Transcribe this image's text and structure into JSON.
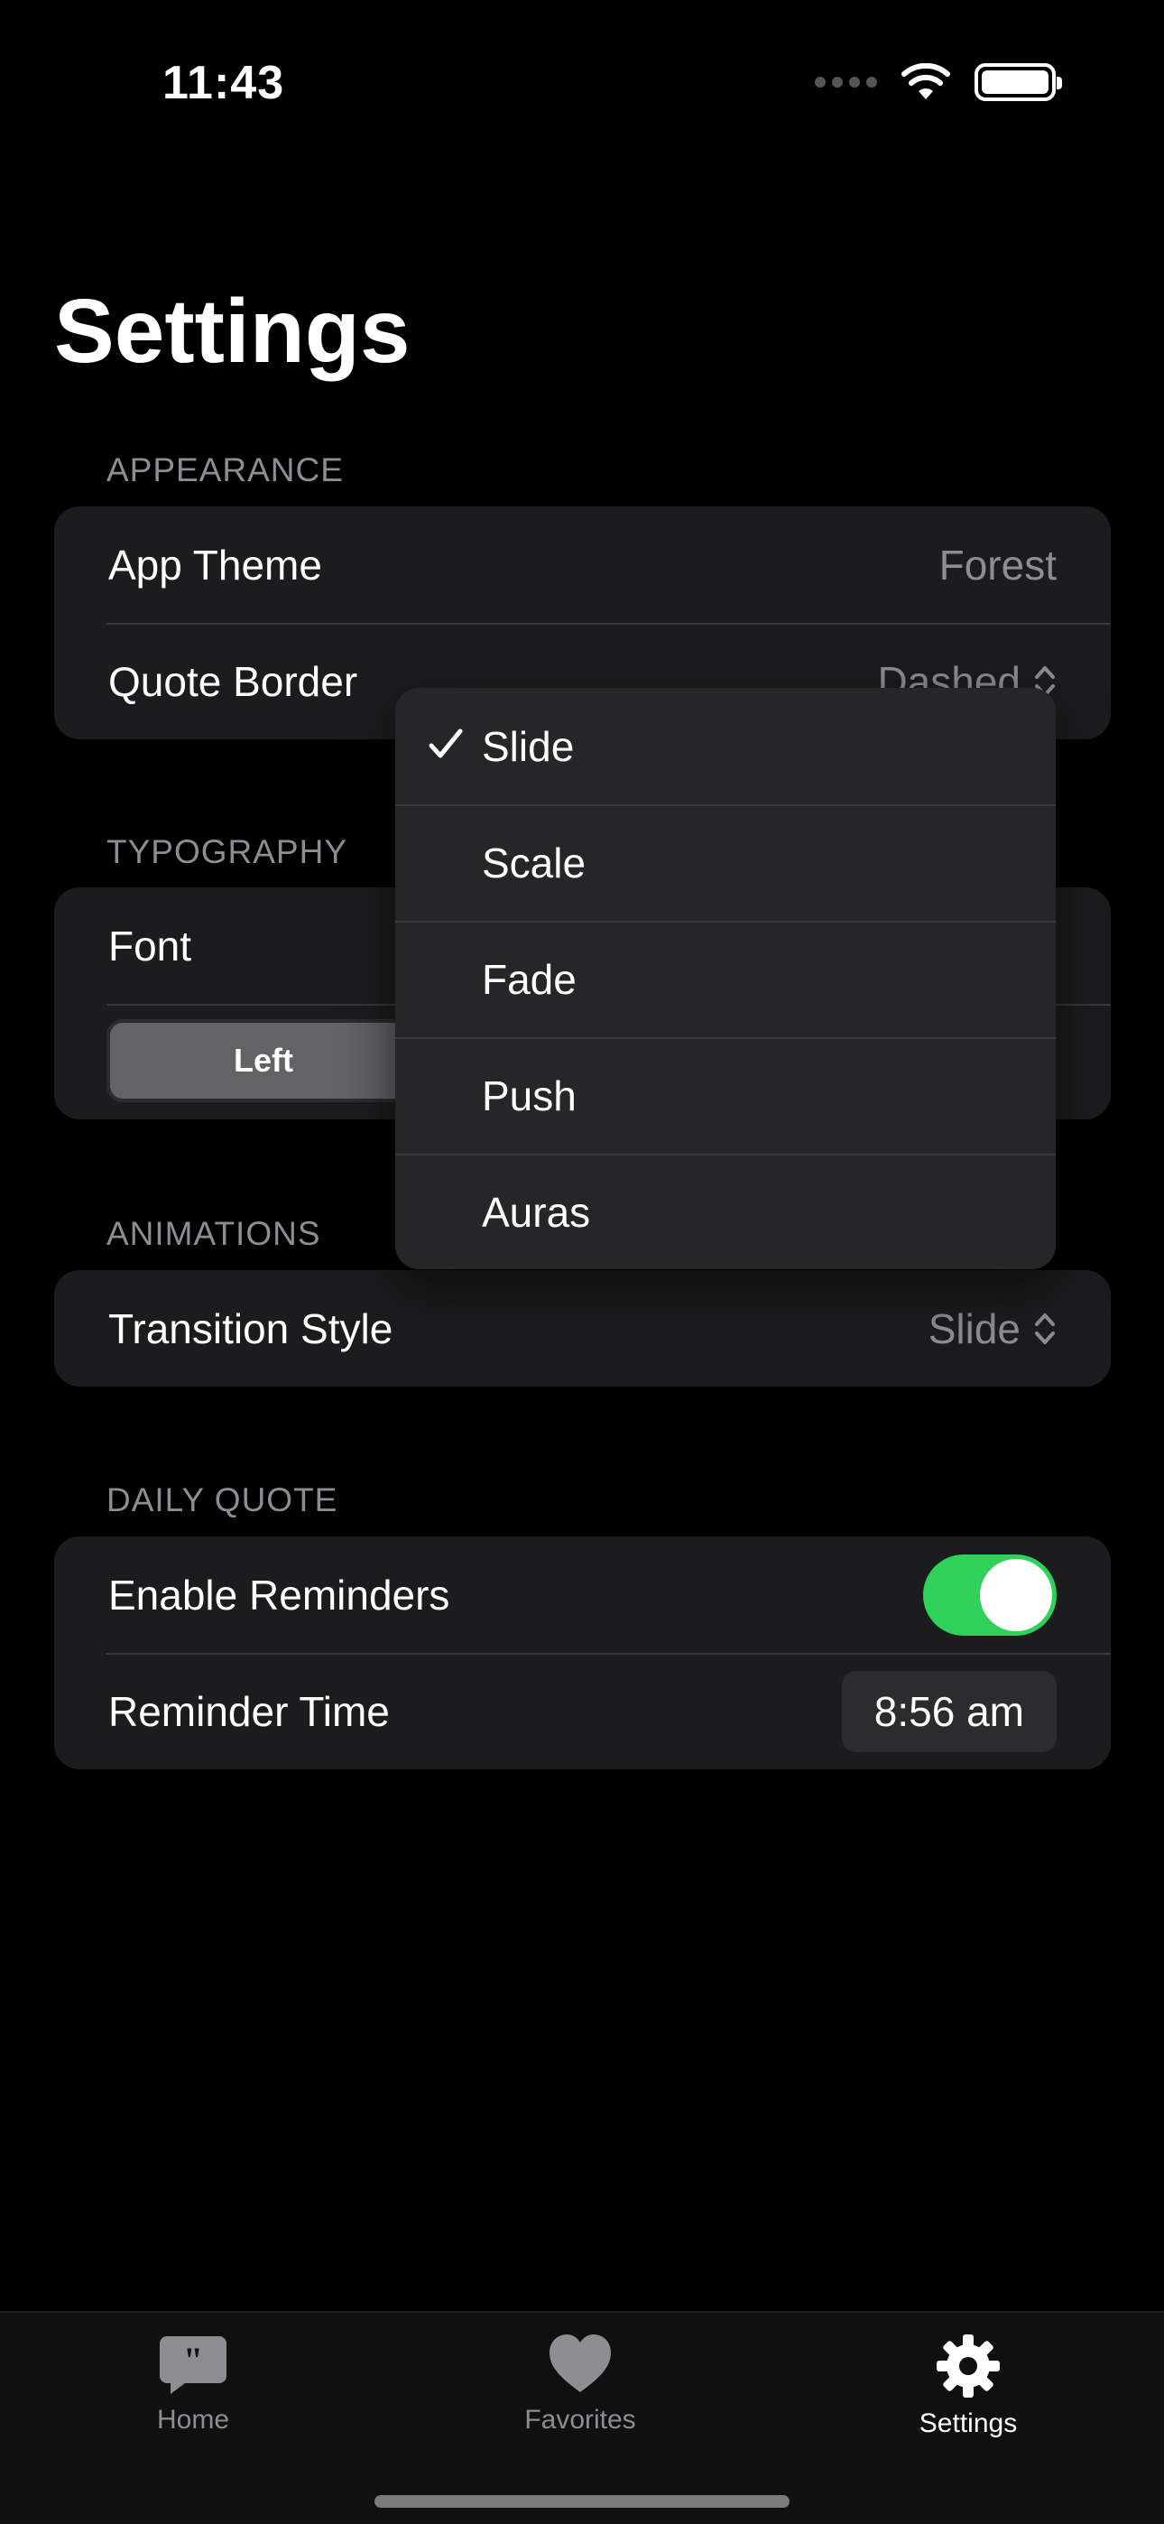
{
  "status_bar": {
    "time": "11:43"
  },
  "title": "Settings",
  "sections": {
    "appearance": {
      "header": "APPEARANCE",
      "app_theme_label": "App Theme",
      "app_theme_value": "Forest",
      "quote_border_label": "Quote Border",
      "quote_border_value": "Dashed"
    },
    "typography": {
      "header": "TYPOGRAPHY",
      "font_label": "Font",
      "alignment_selected": "Left"
    },
    "animations": {
      "header": "ANIMATIONS",
      "transition_label": "Transition Style",
      "transition_value": "Slide"
    },
    "daily_quote": {
      "header": "DAILY QUOTE",
      "reminders_label": "Enable Reminders",
      "reminders_on": true,
      "reminder_time_label": "Reminder Time",
      "reminder_time_value": "8:56 am"
    }
  },
  "dropdown": {
    "selected": "Slide",
    "options": [
      "Slide",
      "Scale",
      "Fade",
      "Push",
      "Auras"
    ]
  },
  "tab_bar": {
    "tabs": [
      {
        "label": "Home",
        "icon": "quote-bubble-icon",
        "active": false
      },
      {
        "label": "Favorites",
        "icon": "heart-icon",
        "active": false
      },
      {
        "label": "Settings",
        "icon": "gear-icon",
        "active": true
      }
    ]
  },
  "colors": {
    "background": "#000000",
    "group_background": "#1c1c1e",
    "secondary_text": "#8d8d93",
    "toggle_on": "#30d158",
    "tab_inactive": "#8d8d93",
    "tab_active": "#ffffff"
  }
}
